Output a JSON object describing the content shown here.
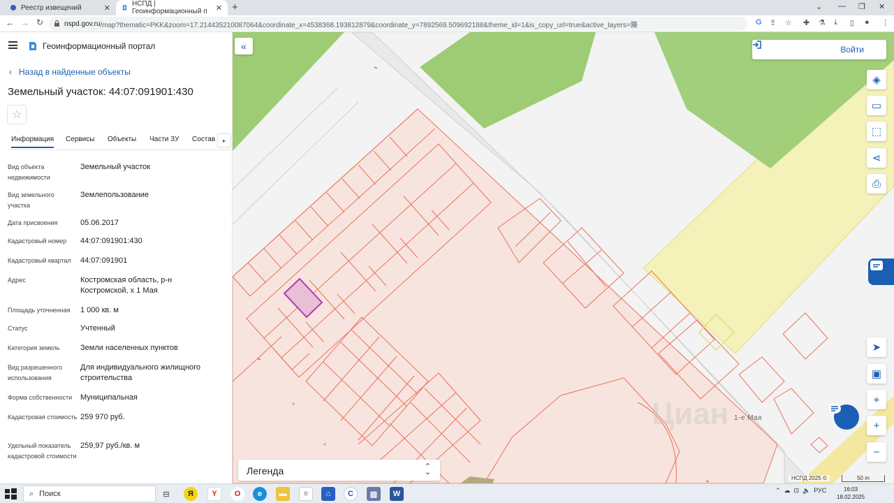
{
  "browser": {
    "tabs": [
      {
        "label": "Реестр извещений",
        "active": false
      },
      {
        "label": "НСПД | Геоинформационный п",
        "active": true
      }
    ],
    "url_host": "nspd.gov.ru",
    "url_path": "/map?thematic=PKK&zoom=17.214435210087064&coordinate_x=4538368.193812879&coordinate_y=7892569.509692188&theme_id=1&is_copy_url=true&active_layers=䧪"
  },
  "header": {
    "portal_title": "Геоинформационный портал"
  },
  "panel": {
    "back_label": "Назад в найденные объекты",
    "object_title": "Земельный участок: 44:07:091901:430",
    "tabs": [
      "Информация",
      "Сервисы",
      "Объекты",
      "Части ЗУ",
      "Состав"
    ],
    "attributes": [
      {
        "label": "Вид объекта недвижимости",
        "value": "Земельный участок"
      },
      {
        "label": "Вид земельного участка",
        "value": "Землепользование"
      },
      {
        "label": "Дата присвоения",
        "value": "05.06.2017"
      },
      {
        "label": "Кадастровый номер",
        "value": "44:07:091901:430"
      },
      {
        "label": "Кадастровый квартал",
        "value": "44:07:091901"
      },
      {
        "label": "Адрес",
        "value": "Костромская область, р-н Костромской, х 1 Мая"
      },
      {
        "label": "Площадь уточненная",
        "value": "1 000 кв. м"
      },
      {
        "label": "Статус",
        "value": "Учтенный"
      },
      {
        "label": "Категория земель",
        "value": "Земли населенных пунктов"
      },
      {
        "label": "Вид разрешенного использования",
        "value": "Для индивидуального жилищного строительства"
      },
      {
        "label": "Форма собственности",
        "value": "Муниципальная"
      },
      {
        "label": "Кадастровая стоимость",
        "value": "259 970 руб."
      },
      {
        "label": "Удельный показатель кадастровой стоимости",
        "value": "259,97 руб./кв. м"
      }
    ]
  },
  "map": {
    "login_label": "Войти",
    "legend_label": "Легенда",
    "street_label": "1-е Мая",
    "copyright": "НСПД 2025 ©",
    "scale_label": "50 m",
    "colors": {
      "parcel_fill": "#f7e4df",
      "parcel_stroke": "#e9735a",
      "selected_fill": "#e8bfd6",
      "selected_stroke": "#b23aa8",
      "forest": "#9dcc74",
      "yellow_zone": "#f4f2b8",
      "accent": "#1a5fb4"
    }
  },
  "taskbar": {
    "search_label": "Поиск",
    "tray_lang": "РУС",
    "time": "16:03",
    "date": "18.02.2025"
  }
}
